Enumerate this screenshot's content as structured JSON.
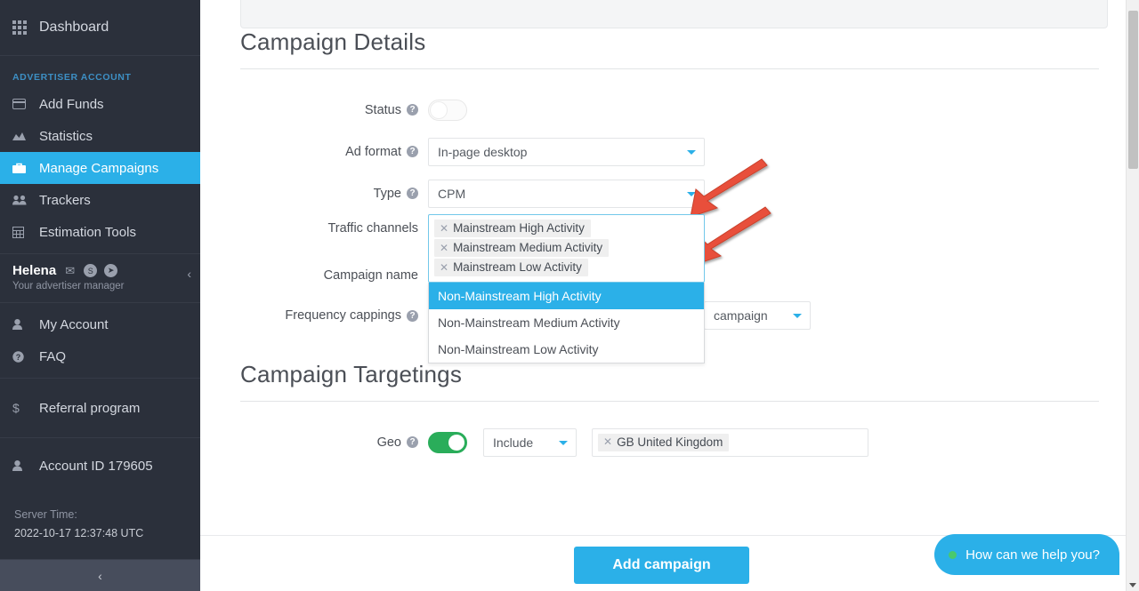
{
  "sidebar": {
    "dashboard": {
      "label": "Dashboard",
      "icon": "grid-icon"
    },
    "section_title": "ADVERTISER ACCOUNT",
    "account_items": [
      {
        "label": "Add Funds",
        "icon": "credit-card-icon"
      },
      {
        "label": "Statistics",
        "icon": "chart-area-icon"
      },
      {
        "label": "Manage Campaigns",
        "icon": "briefcase-icon"
      },
      {
        "label": "Trackers",
        "icon": "users-icon"
      },
      {
        "label": "Estimation Tools",
        "icon": "calculator-icon"
      }
    ],
    "active_item": "Manage Campaigns",
    "manager": {
      "name": "Helena",
      "subtitle": "Your advertiser manager",
      "contacts": [
        "envelope-icon",
        "skype-icon",
        "telegram-icon"
      ],
      "collapse": "‹"
    },
    "help_items": [
      {
        "label": "My Account",
        "icon": "user-icon"
      },
      {
        "label": "FAQ",
        "icon": "question-circle-icon"
      }
    ],
    "referral": {
      "label": "Referral program",
      "icon": "dollar-icon"
    },
    "account_id": {
      "label": "Account ID 179605",
      "icon": "user-icon"
    },
    "server_time": {
      "label": "Server Time:",
      "value": "2022-10-17 12:37:48 UTC"
    },
    "footer_collapse": "‹"
  },
  "campaign_details": {
    "heading": "Campaign Details",
    "status": {
      "label": "Status",
      "state": "off"
    },
    "ad_format": {
      "label": "Ad format",
      "value": "In-page desktop"
    },
    "type": {
      "label": "Type",
      "value": "CPM"
    },
    "traffic_channels": {
      "label": "Traffic channels",
      "selected_tags": [
        "Mainstream High Activity",
        "Mainstream Medium Activity",
        "Mainstream Low Activity"
      ],
      "options": [
        {
          "label": "Non-Mainstream High Activity",
          "highlighted": true
        },
        {
          "label": "Non-Mainstream Medium Activity",
          "highlighted": false
        },
        {
          "label": "Non-Mainstream Low Activity",
          "highlighted": false
        }
      ]
    },
    "campaign_name": {
      "label": "Campaign name"
    },
    "frequency_cappings": {
      "label": "Frequency cappings",
      "period": "campaign"
    }
  },
  "campaign_targetings": {
    "heading": "Campaign Targetings",
    "geo": {
      "label": "Geo",
      "toggle_state": "on",
      "mode": "Include",
      "tags": [
        "GB United Kingdom"
      ]
    }
  },
  "footer": {
    "add_campaign": "Add campaign",
    "chat": "How can we help you?"
  },
  "colors": {
    "accent": "#2bb0e8",
    "sidebar_bg": "#2b303b",
    "toggle_on": "#2aad5a",
    "annotation": "#e8503a"
  }
}
